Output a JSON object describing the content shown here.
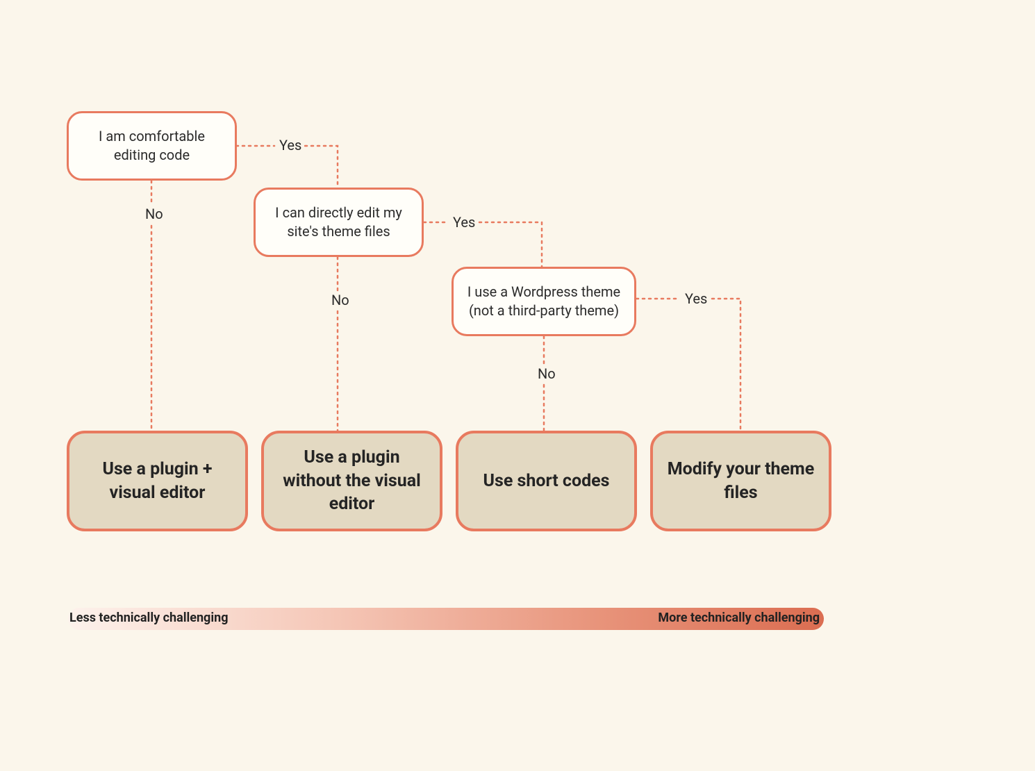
{
  "questions": {
    "q1": "I am comfortable editing code",
    "q2": "I can directly edit my site's theme files",
    "q3": "I use a Wordpress theme (not a third-party theme)"
  },
  "answers": {
    "yes": "Yes",
    "no": "No"
  },
  "outcomes": {
    "o1": "Use a plugin + visual editor",
    "o2": "Use a plugin without the visual editor",
    "o3": "Use short codes",
    "o4": "Modify your theme files"
  },
  "gradient": {
    "left_label": "Less technically challenging",
    "right_label": "More technically challenging"
  },
  "colors": {
    "accent": "#e87a5f",
    "outcome_fill": "#e3d9c2",
    "background": "#fbf6eb"
  }
}
